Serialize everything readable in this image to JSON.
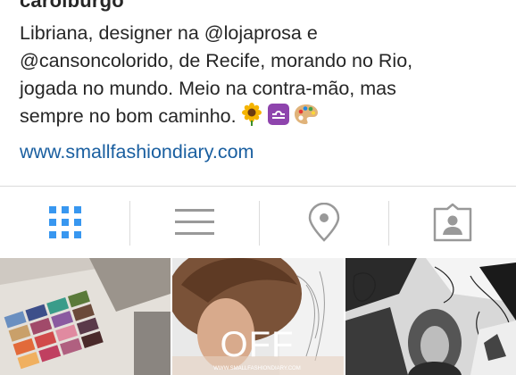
{
  "profile": {
    "username": "carolburgo",
    "bio_lines": [
      "Libriana, designer na @lojaprosa e",
      "@cansoncolorido, de Recife, morando no Rio,",
      "jogada no mundo. Meio na contra-mão, mas",
      "sempre no bom caminho."
    ],
    "bio_emojis": [
      "sunflower-emoji",
      "libra-emoji",
      "artist-palette-emoji"
    ],
    "website": "www.smallfashiondiary.com"
  },
  "tabs": [
    {
      "name": "grid-view",
      "icon": "grid-icon",
      "active": true
    },
    {
      "name": "list-view",
      "icon": "list-icon",
      "active": false
    },
    {
      "name": "photo-map",
      "icon": "location-pin-icon",
      "active": false
    },
    {
      "name": "tagged-photos",
      "icon": "tagged-person-icon",
      "active": false
    }
  ],
  "colors": {
    "active_tab": "#3897f0",
    "inactive_tab": "#999999",
    "link": "#1a5fa0",
    "divider": "#dbdbdb"
  },
  "posts": [
    {
      "description": "fabric swatches"
    },
    {
      "overlay_text": "OFF",
      "caption": "WWW.SMALLFASHIONDIARY.COM"
    },
    {
      "description": "black and white illustration"
    }
  ]
}
